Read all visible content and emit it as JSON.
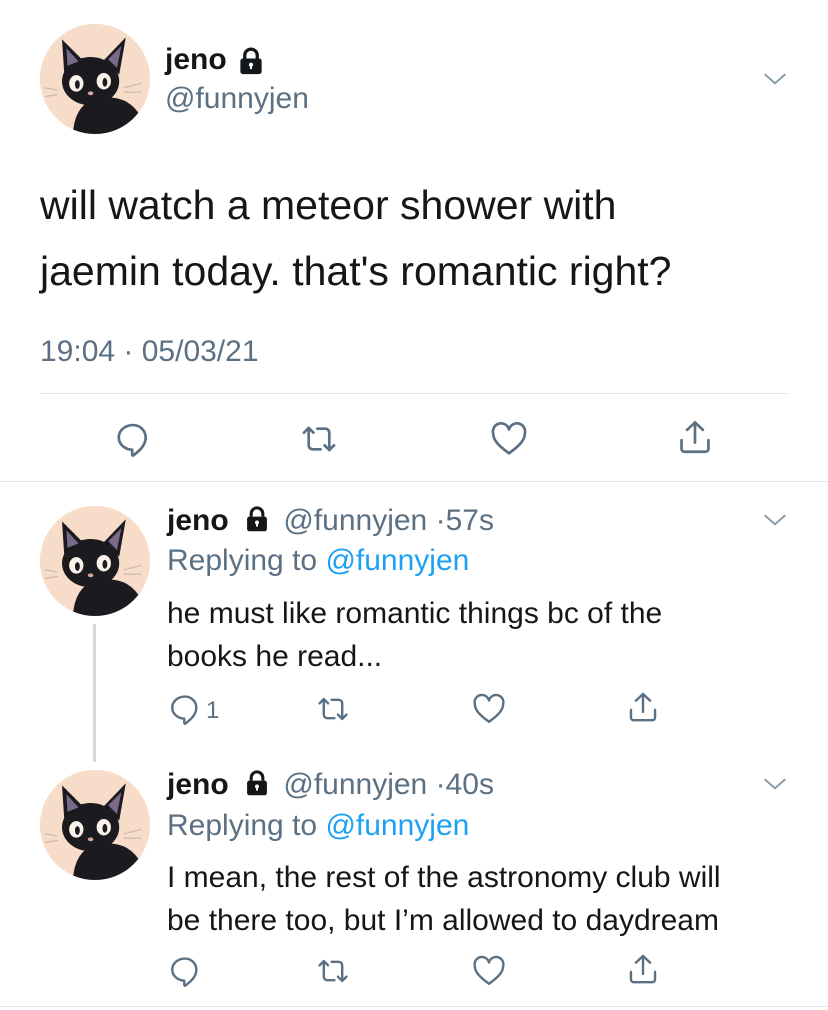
{
  "main_tweet": {
    "display_name": "jeno",
    "handle": "@funnyjen",
    "text_line1": "will watch a meteor shower with",
    "text_line2": "jaemin today. that's romantic right?",
    "timestamp": "19:04 · 05/03/21"
  },
  "replies": [
    {
      "display_name": "jeno",
      "handle": "@funnyjen",
      "separator": "·",
      "time": "57s",
      "replying_prefix": "Replying to",
      "replying_to": "@funnyjen",
      "text_line1": "he must like romantic things bc of the",
      "text_line2": "books he read...",
      "reply_count": "1"
    },
    {
      "display_name": "jeno",
      "handle": "@funnyjen",
      "separator": "·",
      "time": "40s",
      "replying_prefix": "Replying to",
      "replying_to": "@funnyjen",
      "text_line1": "I mean, the rest of the astronomy club will",
      "text_line2": "be there too, but I’m allowed to daydream",
      "reply_count": ""
    }
  ],
  "icons": {
    "avatar": "black-cat-avatar",
    "lock": "lock-icon",
    "chevron": "chevron-down-icon",
    "reply": "reply-icon",
    "retweet": "retweet-icon",
    "like": "heart-icon",
    "share": "share-icon"
  },
  "colors": {
    "text": "#14171a",
    "muted": "#5b7083",
    "link": "#1da1f2",
    "divider": "#dfe3e6",
    "avatar_bg": "#f6dcc9"
  }
}
